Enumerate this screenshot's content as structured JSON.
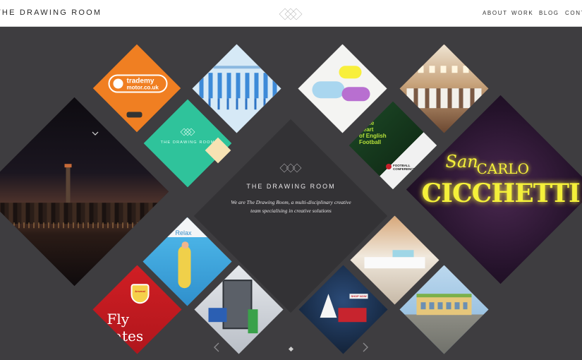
{
  "header": {
    "logo": "THE DRAWING ROOM",
    "nav": [
      "ABOUT",
      "WORK",
      "BLOG",
      "CONTACT"
    ]
  },
  "center": {
    "title": "THE DRAWING ROOM",
    "description_line1": "We are The Drawing Room, a multi-disciplinary creative",
    "description_line2": "team specialising in creative solutions"
  },
  "tiles": {
    "trademy": {
      "line1": "trademy",
      "line2": "motor.co.uk"
    },
    "green": {
      "label": "THE DRAWING ROOM"
    },
    "relax": {
      "label": "Relax"
    },
    "arsenal": {
      "badge": "Arsenal",
      "line1": "Fly",
      "line2": "rates"
    },
    "neon": {
      "line1": "San",
      "line2": "CARLO",
      "line3": "CICCHETTI"
    },
    "football": {
      "line1": "at",
      "line2": "at the",
      "line3": "Heart",
      "line4": "of English",
      "line5": "Football",
      "brand1": "FOOTBALL",
      "brand2": "CONFERENCE"
    },
    "christmas": {
      "sign": "SHOP NOW"
    }
  },
  "colors": {
    "header_bg": "#ffffff",
    "stage_bg": "#3e3d40",
    "orange": "#f07f22",
    "green": "#2fc39b",
    "neon_yellow": "#f4f03a"
  },
  "icons": {
    "prev": "chevron-left-icon",
    "next": "chevron-right-icon",
    "scroll": "chevron-down-icon"
  }
}
